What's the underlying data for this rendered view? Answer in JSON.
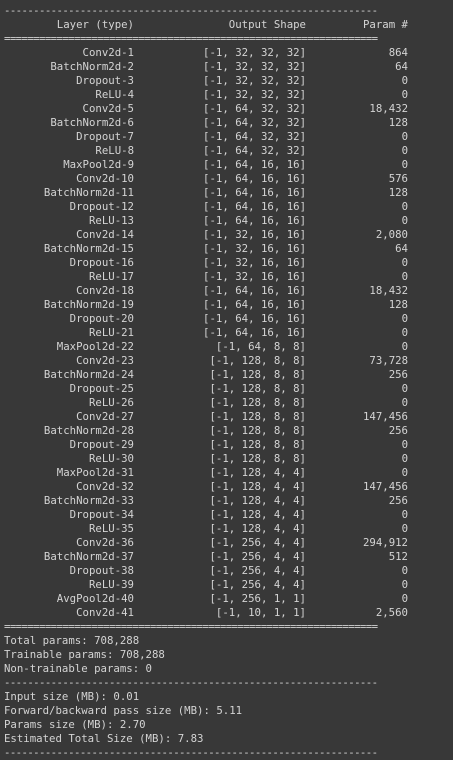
{
  "header": {
    "layer": "Layer (type)",
    "shape": "Output Shape",
    "param": "Param #"
  },
  "separators": {
    "double": "================================================================",
    "single": "----------------------------------------------------------------"
  },
  "rows": [
    {
      "layer": "Conv2d-1",
      "shape": "[-1, 32, 32, 32]",
      "param": "864"
    },
    {
      "layer": "BatchNorm2d-2",
      "shape": "[-1, 32, 32, 32]",
      "param": "64"
    },
    {
      "layer": "Dropout-3",
      "shape": "[-1, 32, 32, 32]",
      "param": "0"
    },
    {
      "layer": "ReLU-4",
      "shape": "[-1, 32, 32, 32]",
      "param": "0"
    },
    {
      "layer": "Conv2d-5",
      "shape": "[-1, 64, 32, 32]",
      "param": "18,432"
    },
    {
      "layer": "BatchNorm2d-6",
      "shape": "[-1, 64, 32, 32]",
      "param": "128"
    },
    {
      "layer": "Dropout-7",
      "shape": "[-1, 64, 32, 32]",
      "param": "0"
    },
    {
      "layer": "ReLU-8",
      "shape": "[-1, 64, 32, 32]",
      "param": "0"
    },
    {
      "layer": "MaxPool2d-9",
      "shape": "[-1, 64, 16, 16]",
      "param": "0"
    },
    {
      "layer": "Conv2d-10",
      "shape": "[-1, 64, 16, 16]",
      "param": "576"
    },
    {
      "layer": "BatchNorm2d-11",
      "shape": "[-1, 64, 16, 16]",
      "param": "128"
    },
    {
      "layer": "Dropout-12",
      "shape": "[-1, 64, 16, 16]",
      "param": "0"
    },
    {
      "layer": "ReLU-13",
      "shape": "[-1, 64, 16, 16]",
      "param": "0"
    },
    {
      "layer": "Conv2d-14",
      "shape": "[-1, 32, 16, 16]",
      "param": "2,080"
    },
    {
      "layer": "BatchNorm2d-15",
      "shape": "[-1, 32, 16, 16]",
      "param": "64"
    },
    {
      "layer": "Dropout-16",
      "shape": "[-1, 32, 16, 16]",
      "param": "0"
    },
    {
      "layer": "ReLU-17",
      "shape": "[-1, 32, 16, 16]",
      "param": "0"
    },
    {
      "layer": "Conv2d-18",
      "shape": "[-1, 64, 16, 16]",
      "param": "18,432"
    },
    {
      "layer": "BatchNorm2d-19",
      "shape": "[-1, 64, 16, 16]",
      "param": "128"
    },
    {
      "layer": "Dropout-20",
      "shape": "[-1, 64, 16, 16]",
      "param": "0"
    },
    {
      "layer": "ReLU-21",
      "shape": "[-1, 64, 16, 16]",
      "param": "0"
    },
    {
      "layer": "MaxPool2d-22",
      "shape": "[-1, 64, 8, 8]",
      "param": "0"
    },
    {
      "layer": "Conv2d-23",
      "shape": "[-1, 128, 8, 8]",
      "param": "73,728"
    },
    {
      "layer": "BatchNorm2d-24",
      "shape": "[-1, 128, 8, 8]",
      "param": "256"
    },
    {
      "layer": "Dropout-25",
      "shape": "[-1, 128, 8, 8]",
      "param": "0"
    },
    {
      "layer": "ReLU-26",
      "shape": "[-1, 128, 8, 8]",
      "param": "0"
    },
    {
      "layer": "Conv2d-27",
      "shape": "[-1, 128, 8, 8]",
      "param": "147,456"
    },
    {
      "layer": "BatchNorm2d-28",
      "shape": "[-1, 128, 8, 8]",
      "param": "256"
    },
    {
      "layer": "Dropout-29",
      "shape": "[-1, 128, 8, 8]",
      "param": "0"
    },
    {
      "layer": "ReLU-30",
      "shape": "[-1, 128, 8, 8]",
      "param": "0"
    },
    {
      "layer": "MaxPool2d-31",
      "shape": "[-1, 128, 4, 4]",
      "param": "0"
    },
    {
      "layer": "Conv2d-32",
      "shape": "[-1, 128, 4, 4]",
      "param": "147,456"
    },
    {
      "layer": "BatchNorm2d-33",
      "shape": "[-1, 128, 4, 4]",
      "param": "256"
    },
    {
      "layer": "Dropout-34",
      "shape": "[-1, 128, 4, 4]",
      "param": "0"
    },
    {
      "layer": "ReLU-35",
      "shape": "[-1, 128, 4, 4]",
      "param": "0"
    },
    {
      "layer": "Conv2d-36",
      "shape": "[-1, 256, 4, 4]",
      "param": "294,912"
    },
    {
      "layer": "BatchNorm2d-37",
      "shape": "[-1, 256, 4, 4]",
      "param": "512"
    },
    {
      "layer": "Dropout-38",
      "shape": "[-1, 256, 4, 4]",
      "param": "0"
    },
    {
      "layer": "ReLU-39",
      "shape": "[-1, 256, 4, 4]",
      "param": "0"
    },
    {
      "layer": "AvgPool2d-40",
      "shape": "[-1, 256, 1, 1]",
      "param": "0"
    },
    {
      "layer": "Conv2d-41",
      "shape": "[-1, 10, 1, 1]",
      "param": "2,560"
    }
  ],
  "params_summary": [
    "Total params: 708,288",
    "Trainable params: 708,288",
    "Non-trainable params: 0"
  ],
  "size_summary": [
    "Input size (MB): 0.01",
    "Forward/backward pass size (MB): 5.11",
    "Params size (MB): 2.70",
    "Estimated Total Size (MB): 7.83"
  ]
}
